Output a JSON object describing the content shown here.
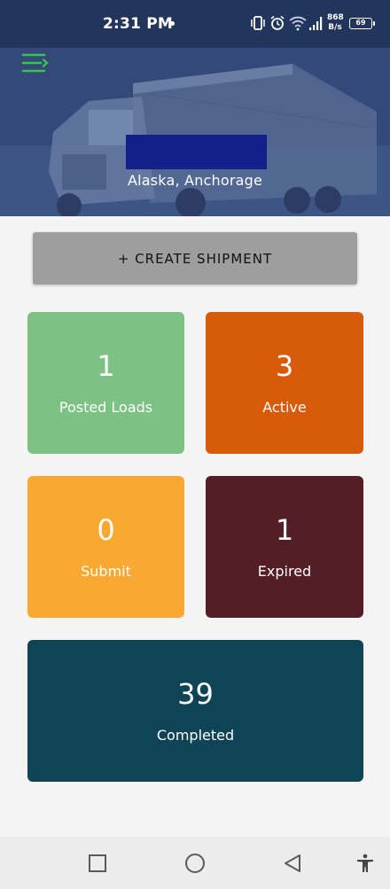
{
  "status_bar": {
    "time": "2:31 PM",
    "net_speed_value": "868",
    "net_speed_unit": "B/s",
    "battery": "69"
  },
  "header": {
    "location": "Alaska, Anchorage",
    "menu_icon": "menu-icon",
    "accent_color": "#35c74a"
  },
  "actions": {
    "create_shipment_label": "+ CREATE SHIPMENT"
  },
  "stats": {
    "posted": {
      "count": "1",
      "label": "Posted Loads",
      "color": "#7cc283"
    },
    "active": {
      "count": "3",
      "label": "Active",
      "color": "#d85a0b"
    },
    "submit": {
      "count": "0",
      "label": "Submit",
      "color": "#fba833"
    },
    "expired": {
      "count": "1",
      "label": "Expired",
      "color": "#541e26"
    },
    "completed": {
      "count": "39",
      "label": "Completed",
      "color": "#0e4456"
    }
  },
  "nav_bar": {
    "icons": [
      "recents-icon",
      "home-icon",
      "back-icon",
      "accessibility-icon"
    ]
  }
}
